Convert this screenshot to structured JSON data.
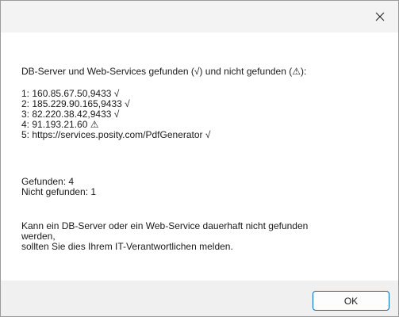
{
  "titlebar": {
    "close_icon": "close-icon"
  },
  "message": {
    "header": "DB-Server und Web-Services gefunden (√) und nicht gefunden (⚠):",
    "entries": [
      "1: 160.85.67.50,9433 √",
      "2: 185.229.90.165,9433 √",
      "3: 82.220.38.42,9433 √",
      "4: 91.193.21.60 ⚠",
      "5: https://services.posity.com/PdfGenerator √"
    ],
    "found": "Gefunden: 4",
    "not_found": "Nicht gefunden: 1",
    "notice_lines": [
      "Kann ein DB-Server oder ein Web-Service dauerhaft nicht gefunden",
      "werden,",
      "sollten Sie dies Ihrem IT-Verantwortlichen melden."
    ]
  },
  "buttons": {
    "ok_label": "OK",
    "accent_color": "#0067c0"
  }
}
